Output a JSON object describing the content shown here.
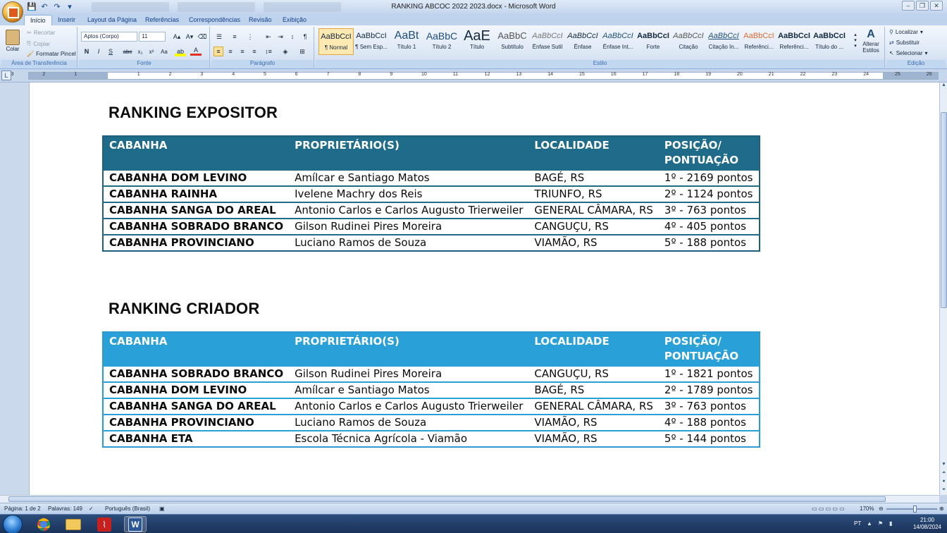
{
  "window": {
    "title": "RANKING ABCOC 2022 2023.docx - Microsoft Word",
    "controls": [
      "–",
      "❐",
      "✕"
    ]
  },
  "ribbon_tabs": [
    "Início",
    "Inserir",
    "Layout da Página",
    "Referências",
    "Correspondências",
    "Revisão",
    "Exibição"
  ],
  "clipboard": {
    "paste_label": "Colar",
    "cut_label": "Recortar",
    "copy_label": "Copiar",
    "format_painter_label": "Formatar Pincel",
    "group_label": "Área de Transferência"
  },
  "font": {
    "name": "Aptos (Corpo)",
    "size": "11",
    "group_label": "Fonte",
    "buttons": [
      "N",
      "I",
      "S",
      "abc",
      "x₂",
      "x²",
      "Aa"
    ]
  },
  "paragraph": {
    "group_label": "Parágrafo"
  },
  "styles": {
    "group_label": "Estilo",
    "items": [
      {
        "preview": "AaBbCcI",
        "name": "¶ Normal"
      },
      {
        "preview": "AaBbCcI",
        "name": "¶ Sem Esp..."
      },
      {
        "preview": "AaBt",
        "name": "Título 1"
      },
      {
        "preview": "AaBbC",
        "name": "Título 2"
      },
      {
        "preview": "AaE",
        "name": "Título"
      },
      {
        "preview": "AaBbC",
        "name": "Subtítulo"
      },
      {
        "preview": "AaBbCcI",
        "name": "Ênfase Sutil"
      },
      {
        "preview": "AaBbCcI",
        "name": "Ênfase"
      },
      {
        "preview": "AaBbCcI",
        "name": "Ênfase Int..."
      },
      {
        "preview": "AaBbCcI",
        "name": "Forte"
      },
      {
        "preview": "AaBbCcI",
        "name": "Citação"
      },
      {
        "preview": "AaBbCcI",
        "name": "Citação In..."
      },
      {
        "preview": "AaBbCcI",
        "name": "Referênci..."
      },
      {
        "preview": "AaBbCcI",
        "name": "Referênci..."
      },
      {
        "preview": "AaBbCcI",
        "name": "Título do ..."
      }
    ],
    "change_styles_label": "Alterar Estilos"
  },
  "editing": {
    "find_label": "Localizar",
    "replace_label": "Substituir",
    "select_label": "Selecionar",
    "group_label": "Edição"
  },
  "ruler_numbers": [
    "3",
    "2",
    "1",
    "1",
    "2",
    "3",
    "4",
    "5",
    "6",
    "7",
    "8",
    "9",
    "10",
    "11",
    "12",
    "13",
    "14",
    "15",
    "16",
    "17",
    "18",
    "19",
    "20",
    "21",
    "22",
    "23",
    "24",
    "25",
    "26"
  ],
  "document": {
    "section1": {
      "heading": "RANKING EXPOSITOR",
      "headers": [
        "CABANHA",
        "PROPRIETÁRIO(S)",
        "LOCALIDADE",
        "POSIÇÃO/ PONTUAÇÃO"
      ],
      "rows": [
        [
          "CABANHA DOM LEVINO",
          "Amílcar e Santiago Matos",
          "BAGÉ, RS",
          "1º - 2169 pontos"
        ],
        [
          "CABANHA RAINHA",
          "Ivelene Machry dos Reis",
          "TRIUNFO, RS",
          "2º - 1124 pontos"
        ],
        [
          "CABANHA SANGA DO AREAL",
          "Antonio Carlos e Carlos Augusto Trierweiler",
          "GENERAL CÂMARA, RS",
          "3º - 763 pontos"
        ],
        [
          "CABANHA SOBRADO BRANCO",
          "Gilson Rudinei Pires Moreira",
          "CANGUÇU, RS",
          "4º - 405 pontos"
        ],
        [
          "CABANHA PROVINCIANO",
          "Luciano Ramos de Souza",
          "VIAMÃO, RS",
          "5º - 188 pontos"
        ]
      ]
    },
    "section2": {
      "heading": "RANKING CRIADOR",
      "headers": [
        "CABANHA",
        "PROPRIETÁRIO(S)",
        "LOCALIDADE",
        "POSIÇÃO/ PONTUAÇÃO"
      ],
      "rows": [
        [
          "CABANHA SOBRADO BRANCO",
          "Gilson Rudinei Pires Moreira",
          "CANGUÇU, RS",
          "1º - 1821 pontos"
        ],
        [
          "CABANHA DOM LEVINO",
          "Amílcar e Santiago Matos",
          "BAGÉ, RS",
          "2º - 1789 pontos"
        ],
        [
          "CABANHA SANGA DO AREAL",
          "Antonio Carlos e Carlos Augusto Trierweiler",
          "GENERAL CÂMARA, RS",
          "3º - 763 pontos"
        ],
        [
          "CABANHA PROVINCIANO",
          "Luciano Ramos de Souza",
          "VIAMÃO, RS",
          "4º - 188 pontos"
        ],
        [
          "CABANHA ETA",
          "Escola Técnica Agrícola - Viamão",
          "VIAMÃO, RS",
          "5º - 144 pontos"
        ]
      ]
    }
  },
  "statusbar": {
    "page": "Página: 1 de 2",
    "words": "Palavras: 149",
    "language": "Português (Brasil)",
    "zoom": "170%"
  },
  "taskbar": {
    "lang": "PT",
    "time": "21:00",
    "date": "14/08/2024"
  },
  "colors": {
    "table1_header": "#1f6b8a",
    "table2_header": "#2aa0d8"
  }
}
